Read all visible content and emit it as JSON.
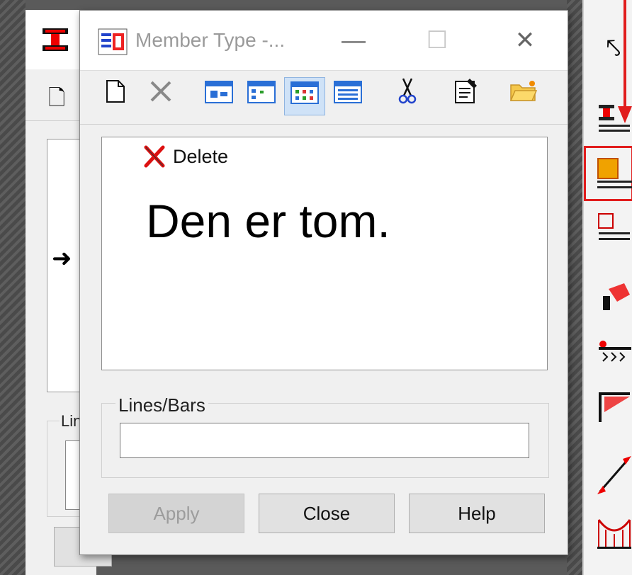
{
  "background_window": {
    "group_label": "Lin"
  },
  "dialog": {
    "title": "Member Type -...",
    "controls": {
      "minimize": "—",
      "maximize": "☐",
      "close": "✕"
    },
    "toolbar": [
      {
        "name": "new-icon",
        "glyph": "🗋"
      },
      {
        "name": "delete-toolbar-icon",
        "glyph": "✕"
      },
      {
        "name": "view-large-icons-icon",
        "glyph": "▣"
      },
      {
        "name": "view-small-icons-icon",
        "glyph": "▣"
      },
      {
        "name": "view-list-icon",
        "glyph": "▦"
      },
      {
        "name": "view-details-icon",
        "glyph": "▤"
      },
      {
        "name": "cut-icon",
        "glyph": "✂"
      },
      {
        "name": "properties-icon",
        "glyph": "🗒"
      },
      {
        "name": "open-folder-icon",
        "glyph": "📂"
      }
    ],
    "context_menu": {
      "delete_label": "Delete"
    },
    "annotation": "Den er tom.",
    "lines_bars": {
      "label": "Lines/Bars",
      "value": ""
    },
    "buttons": {
      "apply": "Apply",
      "close": "Close",
      "help": "Help"
    }
  },
  "colors": {
    "highlight_red": "#e11d1d",
    "pressed_blue": "#cfe2f7"
  }
}
